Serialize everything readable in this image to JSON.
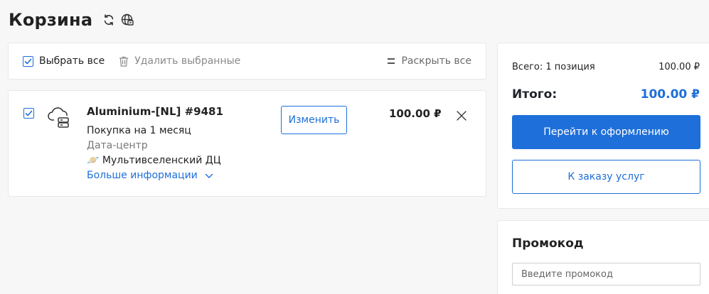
{
  "header": {
    "title": "Корзина",
    "icons": [
      "refresh-icon",
      "globe-icon"
    ]
  },
  "toolbar": {
    "select_all_label": "Выбрать все",
    "select_all_checked": true,
    "delete_selected_label": "Удалить выбранные",
    "expand_all_label": "Раскрыть все"
  },
  "cart": {
    "items": [
      {
        "checked": true,
        "icon": "cloud-server-icon",
        "name": "Aluminium-[NL] #9481",
        "period": "Покупка на 1 месяц",
        "datacenter_label": "Дата-центр",
        "datacenter_icon": "planet-emoji",
        "datacenter_name": "Мультивселенский ДЦ",
        "more_info_label": "Больше информации",
        "change_label": "Изменить",
        "price": "100.00 ₽"
      }
    ]
  },
  "summary": {
    "total_label": "Всего: 1 позиция",
    "total_value": "100.00 ₽",
    "grand_label": "Итого:",
    "grand_value": "100.00 ₽",
    "checkout_label": "Перейти к оформлению",
    "order_services_label": "К заказу услуг"
  },
  "promo": {
    "title": "Промокод",
    "placeholder": "Введите промокод",
    "value": ""
  },
  "colors": {
    "accent": "#1e6fd9",
    "background": "#f7f7f7",
    "card": "#ffffff"
  }
}
